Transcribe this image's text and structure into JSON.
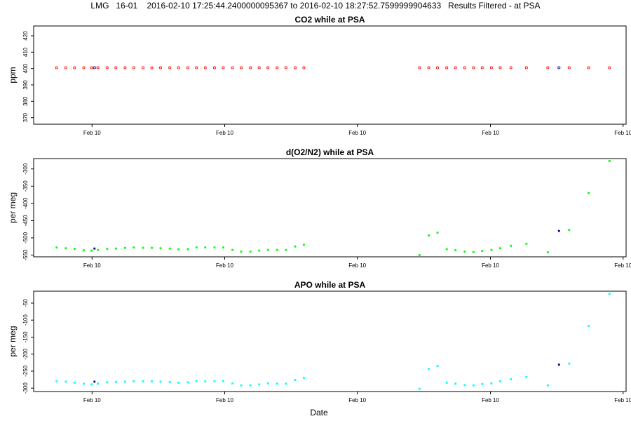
{
  "title": "LMG   16-01    2016-02-10 17:25:44.2400000095367 to 2016-02-10 18:27:52.7599999904633   Results Filtered - at PSA",
  "x_axis_label": "Date",
  "chart_data": [
    {
      "type": "scatter",
      "title": "CO2 while at PSA",
      "ylabel": "ppm",
      "ylim": [
        366,
        426
      ],
      "yticks": [
        370,
        380,
        390,
        400,
        410,
        420
      ],
      "xlim": [
        0,
        100
      ],
      "xticks": [
        {
          "x": 10,
          "label": "Feb 10"
        },
        {
          "x": 37.3,
          "label": "Feb 10"
        },
        {
          "x": 64.6,
          "label": "Feb 10"
        },
        {
          "x": 92,
          "label": "Feb 10"
        },
        {
          "x": 119.3,
          "label": "Feb 10"
        }
      ],
      "color": "#ff0000",
      "marker": "circle",
      "points": [
        {
          "x": 2.7,
          "y": 400.5
        },
        {
          "x": 4.6,
          "y": 400.5
        },
        {
          "x": 6.4,
          "y": 400.5
        },
        {
          "x": 8.3,
          "y": 400.5
        },
        {
          "x": 9.9,
          "y": 400.5
        },
        {
          "x": 10.5,
          "y": 400.5,
          "color": "#000080"
        },
        {
          "x": 11.2,
          "y": 400.5
        },
        {
          "x": 13.1,
          "y": 400.5
        },
        {
          "x": 14.9,
          "y": 400.5
        },
        {
          "x": 16.8,
          "y": 400.5
        },
        {
          "x": 18.6,
          "y": 400.5
        },
        {
          "x": 20.5,
          "y": 400.5
        },
        {
          "x": 22.3,
          "y": 400.5
        },
        {
          "x": 24.1,
          "y": 400.5
        },
        {
          "x": 26.0,
          "y": 400.5
        },
        {
          "x": 27.8,
          "y": 400.5
        },
        {
          "x": 29.7,
          "y": 400.5
        },
        {
          "x": 31.5,
          "y": 400.5
        },
        {
          "x": 33.3,
          "y": 400.5
        },
        {
          "x": 35.2,
          "y": 400.5
        },
        {
          "x": 37.0,
          "y": 400.5
        },
        {
          "x": 38.9,
          "y": 400.5
        },
        {
          "x": 40.7,
          "y": 400.5
        },
        {
          "x": 42.6,
          "y": 400.5
        },
        {
          "x": 44.4,
          "y": 400.5
        },
        {
          "x": 46.2,
          "y": 400.5
        },
        {
          "x": 48.1,
          "y": 400.5
        },
        {
          "x": 49.9,
          "y": 400.5
        },
        {
          "x": 51.8,
          "y": 400.5
        },
        {
          "x": 53.6,
          "y": 400.5
        },
        {
          "x": 77.4,
          "y": 400.5
        },
        {
          "x": 79.3,
          "y": 400.5
        },
        {
          "x": 81.1,
          "y": 400.5
        },
        {
          "x": 83.0,
          "y": 400.5
        },
        {
          "x": 84.8,
          "y": 400.5
        },
        {
          "x": 86.7,
          "y": 400.5
        },
        {
          "x": 88.5,
          "y": 400.5
        },
        {
          "x": 90.3,
          "y": 400.5
        },
        {
          "x": 92.2,
          "y": 400.5
        },
        {
          "x": 94.0,
          "y": 400.5
        },
        {
          "x": 96.2,
          "y": 400.5
        },
        {
          "x": 99.4,
          "y": 400.5
        },
        {
          "x": 103.8,
          "y": 400.5
        },
        {
          "x": 106.1,
          "y": 400.5,
          "color": "#000080"
        },
        {
          "x": 108.2,
          "y": 400.5
        },
        {
          "x": 112.2,
          "y": 400.5
        },
        {
          "x": 116.5,
          "y": 400.5
        }
      ]
    },
    {
      "type": "scatter",
      "title": "d(O2/N2) while at PSA",
      "ylabel": "per meg",
      "ylim": [
        -555,
        -270
      ],
      "yticks": [
        -550,
        -500,
        -450,
        -400,
        -350,
        -300
      ],
      "xlim": [
        0,
        100
      ],
      "xticks": [
        {
          "x": 10,
          "label": "Feb 10"
        },
        {
          "x": 37.3,
          "label": "Feb 10"
        },
        {
          "x": 64.6,
          "label": "Feb 10"
        },
        {
          "x": 92,
          "label": "Feb 10"
        },
        {
          "x": 119.3,
          "label": "Feb 10"
        }
      ],
      "color": "#00ff00",
      "marker": "square",
      "points": [
        {
          "x": 2.7,
          "y": -528
        },
        {
          "x": 4.6,
          "y": -530
        },
        {
          "x": 6.4,
          "y": -532
        },
        {
          "x": 8.3,
          "y": -536
        },
        {
          "x": 9.9,
          "y": -537
        },
        {
          "x": 10.5,
          "y": -531,
          "color": "#000080"
        },
        {
          "x": 11.2,
          "y": -535
        },
        {
          "x": 13.1,
          "y": -532
        },
        {
          "x": 14.9,
          "y": -531
        },
        {
          "x": 16.8,
          "y": -529
        },
        {
          "x": 18.6,
          "y": -528
        },
        {
          "x": 20.5,
          "y": -529
        },
        {
          "x": 22.3,
          "y": -529
        },
        {
          "x": 24.1,
          "y": -530
        },
        {
          "x": 26.0,
          "y": -531
        },
        {
          "x": 27.8,
          "y": -533
        },
        {
          "x": 29.7,
          "y": -533
        },
        {
          "x": 31.5,
          "y": -528
        },
        {
          "x": 33.3,
          "y": -528
        },
        {
          "x": 35.2,
          "y": -528
        },
        {
          "x": 37.0,
          "y": -528
        },
        {
          "x": 38.9,
          "y": -535
        },
        {
          "x": 40.7,
          "y": -540
        },
        {
          "x": 42.6,
          "y": -540
        },
        {
          "x": 44.4,
          "y": -537
        },
        {
          "x": 46.2,
          "y": -535
        },
        {
          "x": 48.1,
          "y": -535
        },
        {
          "x": 49.9,
          "y": -535
        },
        {
          "x": 51.8,
          "y": -525
        },
        {
          "x": 53.6,
          "y": -520
        },
        {
          "x": 77.4,
          "y": -550
        },
        {
          "x": 79.3,
          "y": -493
        },
        {
          "x": 81.1,
          "y": -485
        },
        {
          "x": 83.0,
          "y": -533
        },
        {
          "x": 84.8,
          "y": -536
        },
        {
          "x": 86.7,
          "y": -540
        },
        {
          "x": 88.5,
          "y": -541
        },
        {
          "x": 90.3,
          "y": -538
        },
        {
          "x": 92.2,
          "y": -535
        },
        {
          "x": 94.0,
          "y": -530
        },
        {
          "x": 96.2,
          "y": -523
        },
        {
          "x": 99.4,
          "y": -517
        },
        {
          "x": 103.8,
          "y": -542
        },
        {
          "x": 106.1,
          "y": -480,
          "color": "#000080"
        },
        {
          "x": 108.2,
          "y": -477
        },
        {
          "x": 112.2,
          "y": -370
        },
        {
          "x": 116.5,
          "y": -277
        }
      ]
    },
    {
      "type": "scatter",
      "title": "APO while at PSA",
      "ylabel": "per meg",
      "ylim": [
        -310,
        -15
      ],
      "yticks": [
        -300,
        -250,
        -200,
        -150,
        -100,
        -50
      ],
      "xlim": [
        0,
        100
      ],
      "xticks": [
        {
          "x": 10,
          "label": "Feb 10"
        },
        {
          "x": 37.3,
          "label": "Feb 10"
        },
        {
          "x": 64.6,
          "label": "Feb 10"
        },
        {
          "x": 92,
          "label": "Feb 10"
        },
        {
          "x": 119.3,
          "label": "Feb 10"
        }
      ],
      "color": "#00ffff",
      "marker": "square",
      "points": [
        {
          "x": 2.7,
          "y": -280
        },
        {
          "x": 4.6,
          "y": -281
        },
        {
          "x": 6.4,
          "y": -284
        },
        {
          "x": 8.3,
          "y": -287
        },
        {
          "x": 9.9,
          "y": -289
        },
        {
          "x": 10.5,
          "y": -281,
          "color": "#000080"
        },
        {
          "x": 11.2,
          "y": -287
        },
        {
          "x": 13.1,
          "y": -283
        },
        {
          "x": 14.9,
          "y": -282
        },
        {
          "x": 16.8,
          "y": -281
        },
        {
          "x": 18.6,
          "y": -280
        },
        {
          "x": 20.5,
          "y": -280
        },
        {
          "x": 22.3,
          "y": -280
        },
        {
          "x": 24.1,
          "y": -281
        },
        {
          "x": 26.0,
          "y": -282
        },
        {
          "x": 27.8,
          "y": -284
        },
        {
          "x": 29.7,
          "y": -283
        },
        {
          "x": 31.5,
          "y": -279
        },
        {
          "x": 33.3,
          "y": -280
        },
        {
          "x": 35.2,
          "y": -280
        },
        {
          "x": 37.0,
          "y": -279
        },
        {
          "x": 38.9,
          "y": -286
        },
        {
          "x": 40.7,
          "y": -292
        },
        {
          "x": 42.6,
          "y": -292
        },
        {
          "x": 44.4,
          "y": -289
        },
        {
          "x": 46.2,
          "y": -286
        },
        {
          "x": 48.1,
          "y": -287
        },
        {
          "x": 49.9,
          "y": -287
        },
        {
          "x": 51.8,
          "y": -276
        },
        {
          "x": 53.6,
          "y": -270
        },
        {
          "x": 77.4,
          "y": -302
        },
        {
          "x": 79.3,
          "y": -244
        },
        {
          "x": 81.1,
          "y": -235
        },
        {
          "x": 83.0,
          "y": -284
        },
        {
          "x": 84.8,
          "y": -287
        },
        {
          "x": 86.7,
          "y": -291
        },
        {
          "x": 88.5,
          "y": -292
        },
        {
          "x": 90.3,
          "y": -288
        },
        {
          "x": 92.2,
          "y": -286
        },
        {
          "x": 94.0,
          "y": -280
        },
        {
          "x": 96.2,
          "y": -274
        },
        {
          "x": 99.4,
          "y": -267
        },
        {
          "x": 103.8,
          "y": -292
        },
        {
          "x": 106.1,
          "y": -231,
          "color": "#000080"
        },
        {
          "x": 108.2,
          "y": -228
        },
        {
          "x": 112.2,
          "y": -117
        },
        {
          "x": 116.5,
          "y": -23
        }
      ]
    }
  ]
}
